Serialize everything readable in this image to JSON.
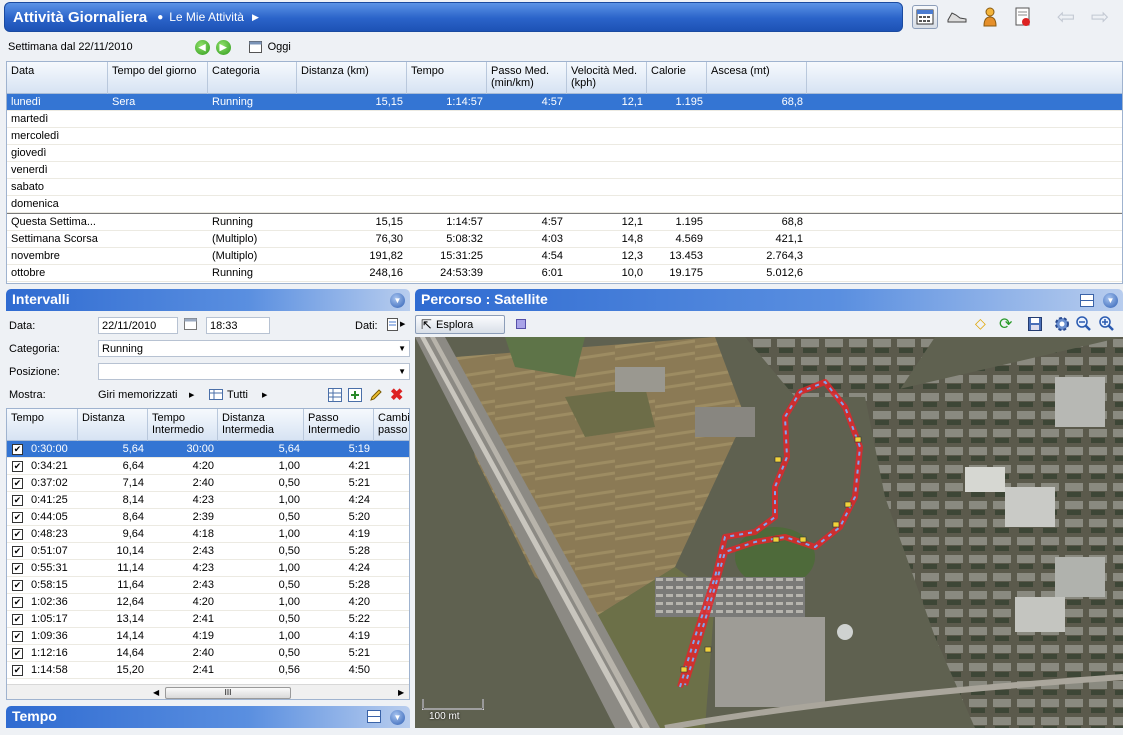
{
  "header": {
    "title": "Attività Giornaliera",
    "subtitle": "Le Mie Attività"
  },
  "week": {
    "label": "Settimana dal 22/11/2010",
    "today_label": "Oggi"
  },
  "week_table": {
    "columns": [
      "Data",
      "Tempo del giorno",
      "Categoria",
      "Distanza (km)",
      "Tempo",
      "Passo Med.\n(min/km)",
      "Velocità Med.\n(kph)",
      "Calorie",
      "Ascesa (mt)"
    ],
    "rows": [
      {
        "day": "lunedì",
        "time_of_day": "Sera",
        "category": "Running",
        "distance": "15,15",
        "time": "1:14:57",
        "pace": "4:57",
        "speed": "12,1",
        "calories": "1.195",
        "ascent": "68,8"
      },
      {
        "day": "martedì",
        "time_of_day": "",
        "category": "",
        "distance": "",
        "time": "",
        "pace": "",
        "speed": "",
        "calories": "",
        "ascent": ""
      },
      {
        "day": "mercoledì",
        "time_of_day": "",
        "category": "",
        "distance": "",
        "time": "",
        "pace": "",
        "speed": "",
        "calories": "",
        "ascent": ""
      },
      {
        "day": "giovedì",
        "time_of_day": "",
        "category": "",
        "distance": "",
        "time": "",
        "pace": "",
        "speed": "",
        "calories": "",
        "ascent": ""
      },
      {
        "day": "venerdì",
        "time_of_day": "",
        "category": "",
        "distance": "",
        "time": "",
        "pace": "",
        "speed": "",
        "calories": "",
        "ascent": ""
      },
      {
        "day": "sabato",
        "time_of_day": "",
        "category": "",
        "distance": "",
        "time": "",
        "pace": "",
        "speed": "",
        "calories": "",
        "ascent": ""
      },
      {
        "day": "domenica",
        "time_of_day": "",
        "category": "",
        "distance": "",
        "time": "",
        "pace": "",
        "speed": "",
        "calories": "",
        "ascent": ""
      }
    ],
    "summary": [
      {
        "day": "Questa Settima...",
        "time_of_day": "",
        "category": "Running",
        "distance": "15,15",
        "time": "1:14:57",
        "pace": "4:57",
        "speed": "12,1",
        "calories": "1.195",
        "ascent": "68,8"
      },
      {
        "day": "Settimana Scorsa",
        "time_of_day": "",
        "category": "(Multiplo)",
        "distance": "76,30",
        "time": "5:08:32",
        "pace": "4:03",
        "speed": "14,8",
        "calories": "4.569",
        "ascent": "421,1"
      },
      {
        "day": "novembre",
        "time_of_day": "",
        "category": "(Multiplo)",
        "distance": "191,82",
        "time": "15:31:25",
        "pace": "4:54",
        "speed": "12,3",
        "calories": "13.453",
        "ascent": "2.764,3"
      },
      {
        "day": "ottobre",
        "time_of_day": "",
        "category": "Running",
        "distance": "248,16",
        "time": "24:53:39",
        "pace": "6:01",
        "speed": "10,0",
        "calories": "19.175",
        "ascent": "5.012,6"
      }
    ]
  },
  "intervals": {
    "title": "Intervalli",
    "date_label": "Data:",
    "date_value": "22/11/2010",
    "time_value": "18:33",
    "data_label": "Dati:",
    "category_label": "Categoria:",
    "category_value": "Running",
    "position_label": "Posizione:",
    "position_value": "",
    "show_label": "Mostra:",
    "show_value": "Giri memorizzati",
    "all_label": "Tutti",
    "columns": [
      "Tempo",
      "Distanza",
      "Tempo\nIntermedio",
      "Distanza\nIntermedia",
      "Passo\nIntermedio",
      "Cambi\npasso"
    ],
    "laps": [
      {
        "checked": true,
        "time": "0:30:00",
        "dist": "5,64",
        "split_time": "30:00",
        "split_dist": "5,64",
        "split_pace": "5:19"
      },
      {
        "checked": true,
        "time": "0:34:21",
        "dist": "6,64",
        "split_time": "4:20",
        "split_dist": "1,00",
        "split_pace": "4:21"
      },
      {
        "checked": true,
        "time": "0:37:02",
        "dist": "7,14",
        "split_time": "2:40",
        "split_dist": "0,50",
        "split_pace": "5:21"
      },
      {
        "checked": true,
        "time": "0:41:25",
        "dist": "8,14",
        "split_time": "4:23",
        "split_dist": "1,00",
        "split_pace": "4:24"
      },
      {
        "checked": true,
        "time": "0:44:05",
        "dist": "8,64",
        "split_time": "2:39",
        "split_dist": "0,50",
        "split_pace": "5:20"
      },
      {
        "checked": true,
        "time": "0:48:23",
        "dist": "9,64",
        "split_time": "4:18",
        "split_dist": "1,00",
        "split_pace": "4:19"
      },
      {
        "checked": true,
        "time": "0:51:07",
        "dist": "10,14",
        "split_time": "2:43",
        "split_dist": "0,50",
        "split_pace": "5:28"
      },
      {
        "checked": true,
        "time": "0:55:31",
        "dist": "11,14",
        "split_time": "4:23",
        "split_dist": "1,00",
        "split_pace": "4:24"
      },
      {
        "checked": true,
        "time": "0:58:15",
        "dist": "11,64",
        "split_time": "2:43",
        "split_dist": "0,50",
        "split_pace": "5:28"
      },
      {
        "checked": true,
        "time": "1:02:36",
        "dist": "12,64",
        "split_time": "4:20",
        "split_dist": "1,00",
        "split_pace": "4:20"
      },
      {
        "checked": true,
        "time": "1:05:17",
        "dist": "13,14",
        "split_time": "2:41",
        "split_dist": "0,50",
        "split_pace": "5:22"
      },
      {
        "checked": true,
        "time": "1:09:36",
        "dist": "14,14",
        "split_time": "4:19",
        "split_dist": "1,00",
        "split_pace": "4:19"
      },
      {
        "checked": true,
        "time": "1:12:16",
        "dist": "14,64",
        "split_time": "2:40",
        "split_dist": "0,50",
        "split_pace": "5:21"
      },
      {
        "checked": true,
        "time": "1:14:58",
        "dist": "15,20",
        "split_time": "2:41",
        "split_dist": "0,56",
        "split_pace": "4:50"
      }
    ],
    "scroll_thumb": "III"
  },
  "tempo": {
    "title": "Tempo"
  },
  "route": {
    "title": "Percorso  : Satellite",
    "explore_label": "Esplora",
    "scale_label": "100 mt"
  },
  "colors": {
    "accent": "#2f6bd1",
    "selection": "#3475d3",
    "route_red": "#e0262a",
    "route_blue": "#5a8ee8"
  }
}
